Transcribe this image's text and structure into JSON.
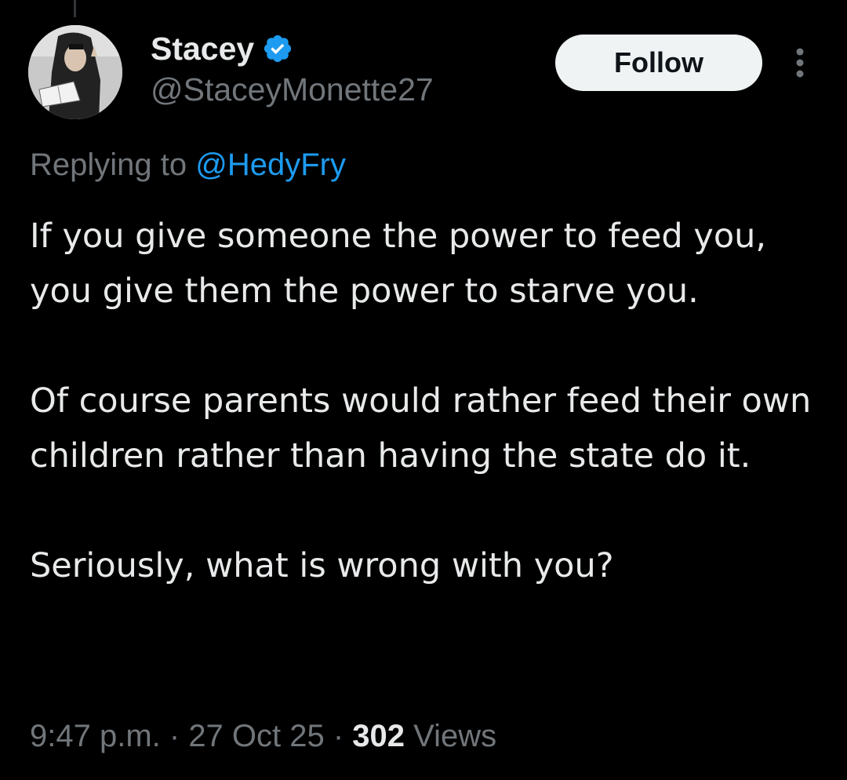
{
  "author": {
    "display_name": "Stacey",
    "handle": "@StaceyMonette27",
    "verified": true,
    "verified_color": "#1d9bf0",
    "avatar_icon": "profile-photo-avatar"
  },
  "actions": {
    "follow_label": "Follow",
    "more_icon": "more-vertical-icon"
  },
  "reply": {
    "prefix": "Replying to ",
    "target": "@HedyFry"
  },
  "tweet": {
    "paragraphs": [
      "If you give someone the power to feed you, you give them the power to starve you.",
      "Of course parents would rather feed their own children rather than having the state do it.",
      "Seriously, what is wrong with you?"
    ]
  },
  "meta": {
    "time": "9:47 p.m.",
    "separator": " · ",
    "date": "27 Oct 25",
    "views_count": "302",
    "views_label": " Views"
  },
  "colors": {
    "background": "#000000",
    "text_primary": "#e7e9ea",
    "text_secondary": "#71767b",
    "accent_link": "#1d9bf0",
    "follow_bg": "#eff3f4"
  }
}
